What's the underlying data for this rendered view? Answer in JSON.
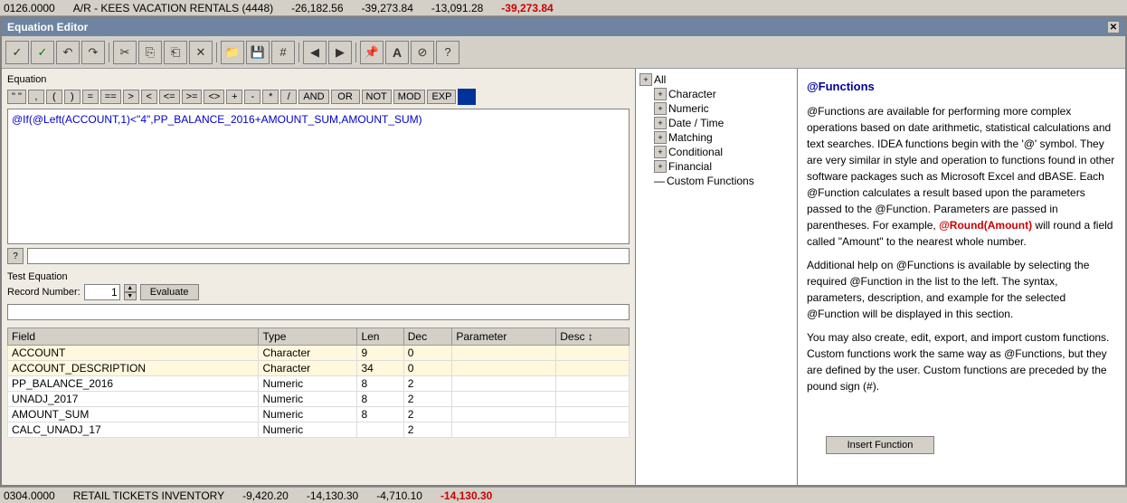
{
  "topBar": {
    "col1": "0126.0000",
    "col2": "A/R - KEES VACATION RENTALS (4448)",
    "col3": "-26,182.56",
    "col4": "-39,273.84",
    "col5": "-13,091.28",
    "col6": "-39,273.84"
  },
  "bottomBar": {
    "col1": "0304.0000",
    "col2": "RETAIL TICKETS INVENTORY",
    "col3": "-9,420.20",
    "col4": "-14,130.30",
    "col5": "-4,710.10",
    "col6": "-14,130.30"
  },
  "window": {
    "title": "Equation Editor"
  },
  "toolbar": {
    "buttons": [
      "✓",
      "✓",
      "↶",
      "↷",
      "✂",
      "⎘",
      "⎗",
      "✕",
      "📁",
      "💾",
      "#",
      "◀",
      "▶",
      "📌",
      "A",
      "⊘",
      "?"
    ]
  },
  "equation": {
    "label": "Equation",
    "operators": [
      "\" \"",
      ",",
      "(",
      ")",
      "=",
      "==",
      ">",
      "<",
      "<=",
      ">=",
      "<>",
      "+",
      "-",
      "*",
      "/",
      "AND",
      "OR",
      "NOT",
      "MOD",
      "EXP"
    ],
    "text": "@If(@Left(ACCOUNT,1)<\"4\",PP_BALANCE_2016+AMOUNT_SUM,AMOUNT_SUM)"
  },
  "help": {
    "buttonLabel": "?",
    "placeholder": ""
  },
  "testEquation": {
    "label": "Test Equation",
    "recordLabel": "Record Number:",
    "recordValue": "1",
    "evaluateLabel": "Evaluate"
  },
  "table": {
    "headers": [
      "Field",
      "Type",
      "Len",
      "Dec",
      "Parameter",
      "Desc"
    ],
    "rows": [
      {
        "field": "ACCOUNT",
        "type": "Character",
        "len": "9",
        "dec": "0",
        "param": "",
        "desc": ""
      },
      {
        "field": "ACCOUNT_DESCRIPTION",
        "type": "Character",
        "len": "34",
        "dec": "0",
        "param": "",
        "desc": ""
      },
      {
        "field": "PP_BALANCE_2016",
        "type": "Numeric",
        "len": "8",
        "dec": "2",
        "param": "",
        "desc": ""
      },
      {
        "field": "UNADJ_2017",
        "type": "Numeric",
        "len": "8",
        "dec": "2",
        "param": "",
        "desc": ""
      },
      {
        "field": "AMOUNT_SUM",
        "type": "Numeric",
        "len": "8",
        "dec": "2",
        "param": "",
        "desc": ""
      },
      {
        "field": "CALC_UNADJ_17",
        "type": "Numeric",
        "len": "",
        "dec": "2",
        "param": "",
        "desc": ""
      }
    ]
  },
  "functionTree": {
    "items": [
      {
        "label": "All",
        "expanded": true,
        "level": 0
      },
      {
        "label": "Character",
        "expanded": false,
        "level": 1
      },
      {
        "label": "Numeric",
        "expanded": false,
        "level": 1
      },
      {
        "label": "Date / Time",
        "expanded": false,
        "level": 1
      },
      {
        "label": "Matching",
        "expanded": false,
        "level": 1
      },
      {
        "label": "Conditional",
        "expanded": false,
        "level": 1
      },
      {
        "label": "Financial",
        "expanded": false,
        "level": 1
      },
      {
        "label": "Custom Functions",
        "expanded": false,
        "level": 1,
        "noExpander": true
      }
    ]
  },
  "helpPanel": {
    "title": "@Functions",
    "para1": "@Functions are available for performing more complex operations based on date arithmetic, statistical calculations and text searches. IDEA functions begin with the '@' symbol. They are very similar in style and operation to functions found in other software packages such as Microsoft Excel and dBASE. Each @Function calculates a result based upon the parameters passed to the @Function. Parameters are passed in parentheses. For example, @Round(Amount) will round a field called \"Amount\" to the nearest whole number.",
    "highlightText": "@Round(Amount)",
    "para2": "Additional help on @Functions is available by selecting the required @Function in the list to the left. The syntax, parameters, description, and example for the selected @Function will be displayed in this section.",
    "para3": "You may also create, edit, export, and import custom functions. Custom functions work the same way as @Functions, but they are defined by the user. Custom functions are preceded by the pound sign (#).",
    "insertButton": "Insert Function"
  }
}
